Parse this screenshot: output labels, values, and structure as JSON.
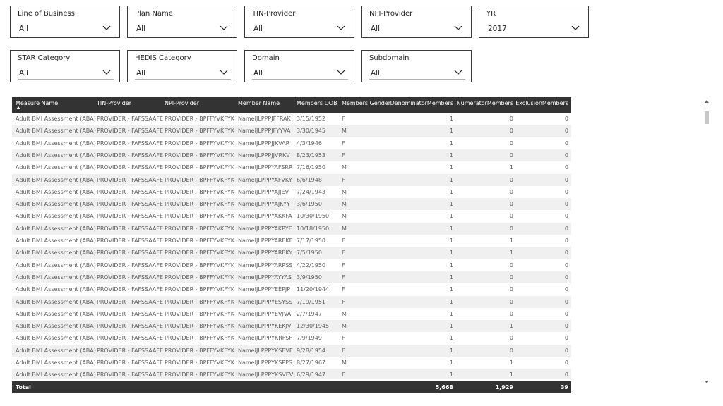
{
  "slicers": [
    {
      "title": "Line of Business",
      "value": "All"
    },
    {
      "title": "Plan Name",
      "value": "All"
    },
    {
      "title": "TIN-Provider",
      "value": "All"
    },
    {
      "title": "NPI-Provider",
      "value": "All"
    },
    {
      "title": "YR",
      "value": "2017"
    },
    {
      "title": "STAR Category",
      "value": "All"
    },
    {
      "title": "HEDIS Category",
      "value": "All"
    },
    {
      "title": "Domain",
      "value": "All"
    },
    {
      "title": "Subdomain",
      "value": "All"
    }
  ],
  "table": {
    "headers": [
      "Measure Name",
      "TIN-Provider",
      "NPI-Provider",
      "Member Name",
      "Members DOB",
      "Members Gender",
      "DenominatorMembers",
      "NumeratorMembers",
      "ExclusionMembers"
    ],
    "rows": [
      [
        "Adult BMI Assessment (ABA)",
        "PROVIDER - FAFSSAAFE",
        "PROVIDER - BPFFYVKFYK",
        "NameIJLPPPJFFRAK",
        "3/15/1952",
        "F",
        "1",
        "0",
        "0"
      ],
      [
        "Adult BMI Assessment (ABA)",
        "PROVIDER - FAFSSAAFE",
        "PROVIDER - BPFFYVKFYK",
        "NameIJLPPPJFYYVA",
        "3/30/1945",
        "M",
        "1",
        "0",
        "0"
      ],
      [
        "Adult BMI Assessment (ABA)",
        "PROVIDER - FAFSSAAFE",
        "PROVIDER - BPFFYVKFYK",
        "NameIJLPPPJJKVAR",
        "4/3/1946",
        "F",
        "1",
        "0",
        "0"
      ],
      [
        "Adult BMI Assessment (ABA)",
        "PROVIDER - FAFSSAAFE",
        "PROVIDER - BPFFYVKFYK",
        "NameIJLPPPJJVRKV",
        "8/23/1953",
        "F",
        "1",
        "0",
        "0"
      ],
      [
        "Adult BMI Assessment (ABA)",
        "PROVIDER - FAFSSAAFE",
        "PROVIDER - BPFFYVKFYK",
        "NameIJLPPPYAFSRR",
        "7/16/1950",
        "M",
        "1",
        "1",
        "0"
      ],
      [
        "Adult BMI Assessment (ABA)",
        "PROVIDER - FAFSSAAFE",
        "PROVIDER - BPFFYVKFYK",
        "NameIJLPPPYAFVKY",
        "6/6/1948",
        "F",
        "1",
        "0",
        "0"
      ],
      [
        "Adult BMI Assessment (ABA)",
        "PROVIDER - FAFSSAAFE",
        "PROVIDER - BPFFYVKFYK",
        "NameIJLPPPYAJJEV",
        "7/24/1943",
        "M",
        "1",
        "0",
        "0"
      ],
      [
        "Adult BMI Assessment (ABA)",
        "PROVIDER - FAFSSAAFE",
        "PROVIDER - BPFFYVKFYK",
        "NameIJLPPPYAJKYY",
        "3/6/1950",
        "M",
        "1",
        "0",
        "0"
      ],
      [
        "Adult BMI Assessment (ABA)",
        "PROVIDER - FAFSSAAFE",
        "PROVIDER - BPFFYVKFYK",
        "NameIJLPPPYAKKFA",
        "10/30/1950",
        "M",
        "1",
        "0",
        "0"
      ],
      [
        "Adult BMI Assessment (ABA)",
        "PROVIDER - FAFSSAAFE",
        "PROVIDER - BPFFYVKFYK",
        "NameIJLPPPYAKPYE",
        "10/18/1950",
        "M",
        "1",
        "0",
        "0"
      ],
      [
        "Adult BMI Assessment (ABA)",
        "PROVIDER - FAFSSAAFE",
        "PROVIDER - BPFFYVKFYK",
        "NameIJLPPPYAREKE",
        "7/17/1950",
        "F",
        "1",
        "1",
        "0"
      ],
      [
        "Adult BMI Assessment (ABA)",
        "PROVIDER - FAFSSAAFE",
        "PROVIDER - BPFFYVKFYK",
        "NameIJLPPPYAREKY",
        "7/5/1950",
        "F",
        "1",
        "1",
        "0"
      ],
      [
        "Adult BMI Assessment (ABA)",
        "PROVIDER - FAFSSAAFE",
        "PROVIDER - BPFFYVKFYK",
        "NameIJLPPPYARPSS",
        "4/22/1950",
        "F",
        "1",
        "0",
        "0"
      ],
      [
        "Adult BMI Assessment (ABA)",
        "PROVIDER - FAFSSAAFE",
        "PROVIDER - BPFFYVKFYK",
        "NameIJLPPPYAYYAS",
        "3/9/1950",
        "F",
        "1",
        "0",
        "0"
      ],
      [
        "Adult BMI Assessment (ABA)",
        "PROVIDER - FAFSSAAFE",
        "PROVIDER - BPFFYVKFYK",
        "NameIJLPPPYEEPJP",
        "11/20/1944",
        "F",
        "1",
        "0",
        "0"
      ],
      [
        "Adult BMI Assessment (ABA)",
        "PROVIDER - FAFSSAAFE",
        "PROVIDER - BPFFYVKFYK",
        "NameIJLPPPYESYSS",
        "7/19/1951",
        "F",
        "1",
        "0",
        "0"
      ],
      [
        "Adult BMI Assessment (ABA)",
        "PROVIDER - FAFSSAAFE",
        "PROVIDER - BPFFYVKFYK",
        "NameIJLPPPYEVJVA",
        "2/7/1947",
        "M",
        "1",
        "0",
        "0"
      ],
      [
        "Adult BMI Assessment (ABA)",
        "PROVIDER - FAFSSAAFE",
        "PROVIDER - BPFFYVKFYK",
        "NameIJLPPPYKEKJV",
        "12/30/1945",
        "M",
        "1",
        "1",
        "0"
      ],
      [
        "Adult BMI Assessment (ABA)",
        "PROVIDER - FAFSSAAFE",
        "PROVIDER - BPFFYVKFYK",
        "NameIJLPPPYKRFSF",
        "7/9/1949",
        "F",
        "1",
        "0",
        "0"
      ],
      [
        "Adult BMI Assessment (ABA)",
        "PROVIDER - FAFSSAAFE",
        "PROVIDER - BPFFYVKFYK",
        "NameIJLPPPYKSEVE",
        "9/28/1954",
        "F",
        "1",
        "0",
        "0"
      ],
      [
        "Adult BMI Assessment (ABA)",
        "PROVIDER - FAFSSAAFE",
        "PROVIDER - BPFFYVKFYK",
        "NameIJLPPPYKSPPS",
        "8/27/1967",
        "M",
        "1",
        "1",
        "0"
      ],
      [
        "Adult BMI Assessment (ABA)",
        "PROVIDER - FAFSSAAFE",
        "PROVIDER - BPFFYVKFYK",
        "NameIJLPPPYKSVEV",
        "6/29/1947",
        "F",
        "1",
        "1",
        "0"
      ]
    ],
    "total": {
      "label": "Total",
      "denominator": "5,668",
      "numerator": "1,929",
      "exclusion": "39"
    },
    "header_bg": "#333333",
    "alt_row_bg": "#f0f0f0"
  }
}
